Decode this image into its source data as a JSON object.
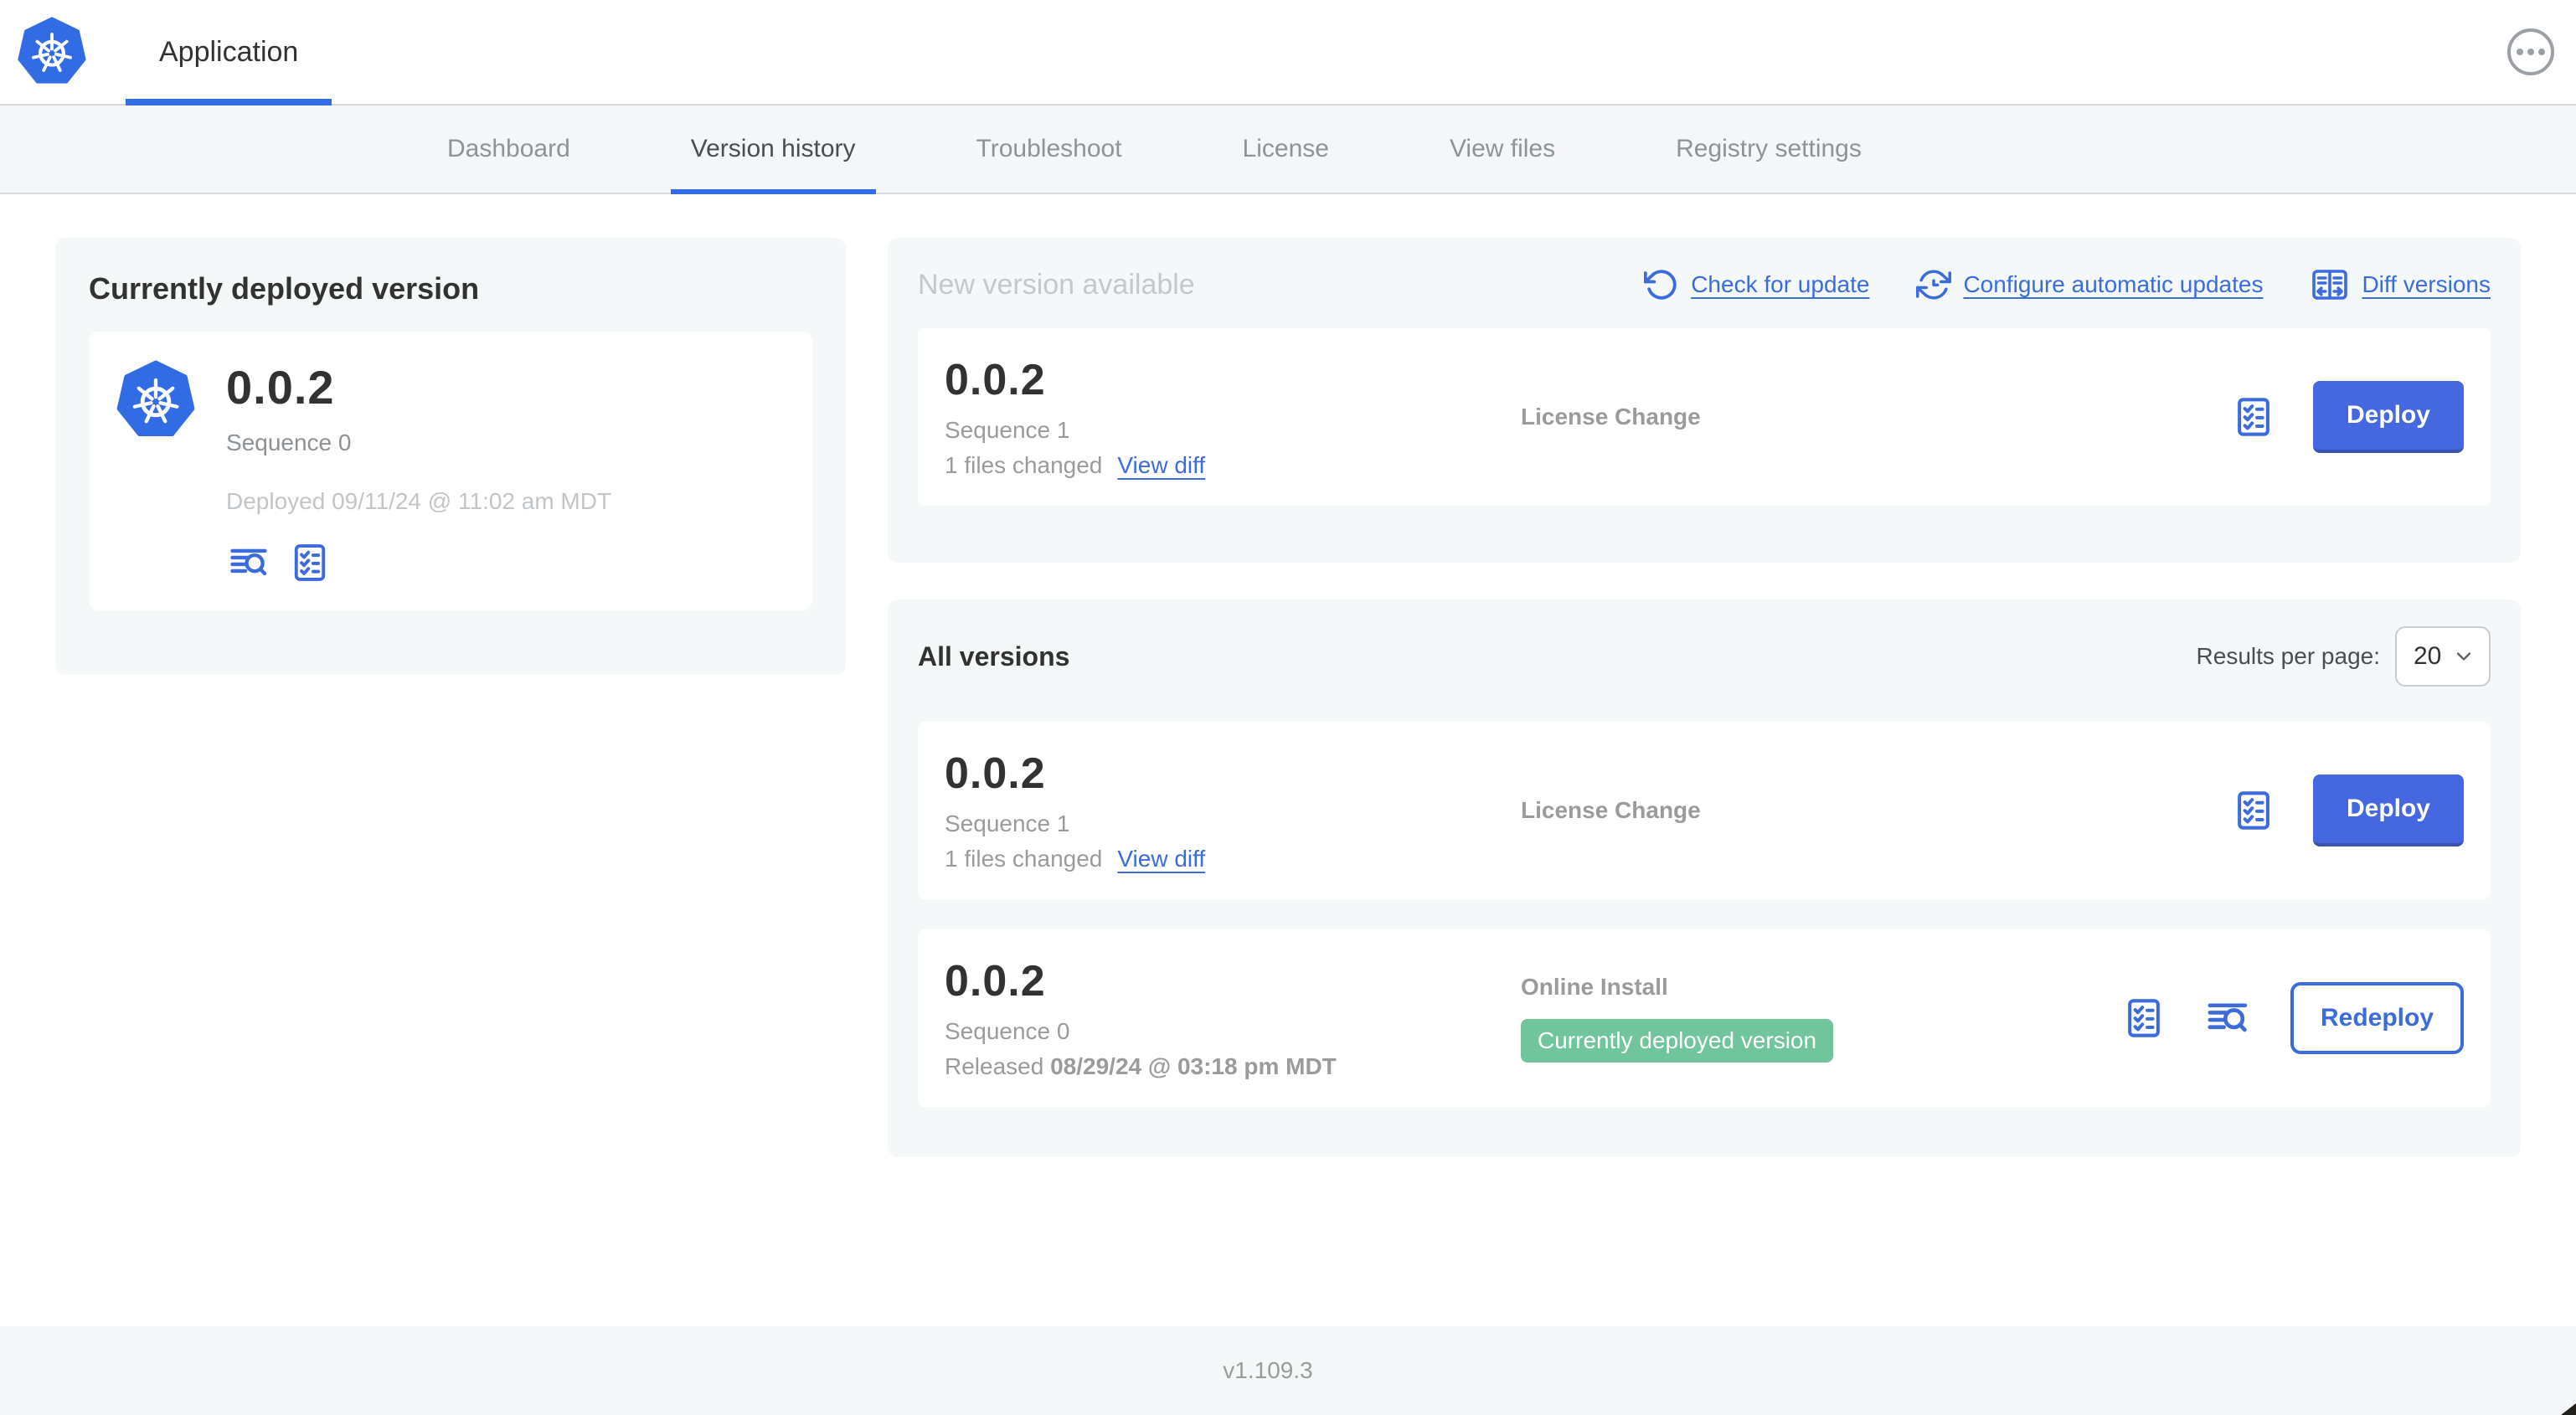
{
  "header": {
    "app_title": "Application",
    "menu_icon": "ellipsis-circle-icon"
  },
  "nav": {
    "tabs": [
      {
        "label": "Dashboard",
        "active": false
      },
      {
        "label": "Version history",
        "active": true
      },
      {
        "label": "Troubleshoot",
        "active": false
      },
      {
        "label": "License",
        "active": false
      },
      {
        "label": "View files",
        "active": false
      },
      {
        "label": "Registry settings",
        "active": false
      }
    ]
  },
  "deployed_card": {
    "title": "Currently deployed version",
    "version": "0.0.2",
    "sequence": "Sequence 0",
    "deployed": "Deployed 09/11/24 @ 11:02 am MDT",
    "icons": [
      "view-logs-icon",
      "preflight-checklist-icon"
    ]
  },
  "new_version": {
    "title": "New version available",
    "actions": [
      {
        "label": "Check for update",
        "icon": "rotate-ccw-icon"
      },
      {
        "label": "Configure automatic updates",
        "icon": "auto-update-clock-icon"
      },
      {
        "label": "Diff versions",
        "icon": "diff-panes-icon"
      }
    ],
    "row": {
      "version": "0.0.2",
      "sequence": "Sequence 1",
      "files_changed": "1 files changed",
      "view_diff": "View diff",
      "source": "License Change",
      "deploy_label": "Deploy",
      "icons": [
        "preflight-checklist-icon"
      ]
    }
  },
  "all_versions": {
    "title": "All versions",
    "results_label": "Results per page:",
    "results_value": "20",
    "rows": [
      {
        "version": "0.0.2",
        "sequence": "Sequence 1",
        "files_changed": "1 files changed",
        "view_diff": "View diff",
        "source": "License Change",
        "deploy_label": "Deploy",
        "icons": [
          "preflight-checklist-icon"
        ]
      },
      {
        "version": "0.0.2",
        "sequence": "Sequence 0",
        "released_prefix": "Released ",
        "released_date": "08/29/24 @ 03:18 pm MDT",
        "source": "Online Install",
        "badge": "Currently deployed version",
        "redeploy_label": "Redeploy",
        "icons": [
          "preflight-checklist-icon",
          "view-logs-icon"
        ]
      }
    ]
  },
  "footer": {
    "version": "v1.109.3"
  },
  "colors": {
    "accent": "#326de6",
    "link": "#3c6cdc",
    "btn": "#4567e0",
    "btn-border": "#3a55b0",
    "green": "#70c59c",
    "panel": "#f5f8f9",
    "dark": "#323232"
  }
}
